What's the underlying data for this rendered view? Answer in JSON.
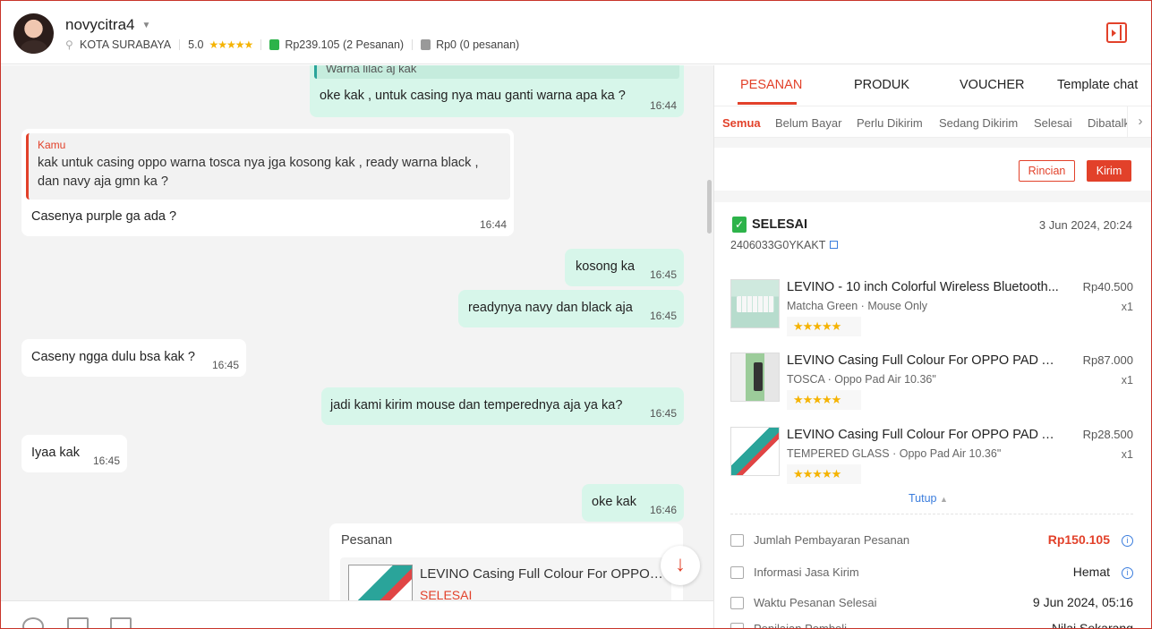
{
  "header": {
    "username": "novycitra4",
    "location": "KOTA SURABAYA",
    "rating": "5.0",
    "stars": "★★★★★",
    "completed_amount": "Rp239.105",
    "completed_count": "(2 Pesanan)",
    "cancelled_amount": "Rp0",
    "cancelled_count": "(0 pesanan)"
  },
  "chat": {
    "messages": [
      {
        "dir": "out",
        "text": "Warna lilac aj kak",
        "time": ""
      },
      {
        "dir": "out",
        "text": "oke kak , untuk casing nya mau ganti warna apa ka ?",
        "time": "16:44"
      },
      {
        "dir": "in",
        "quote_author": "Kamu",
        "quote_text": "kak untuk casing oppo warna tosca nya jga kosong kak , ready warna black , dan navy aja gmn ka ?",
        "text": "Casenya purple ga ada ?",
        "time": "16:44"
      },
      {
        "dir": "out",
        "text": "kosong ka",
        "time": "16:45"
      },
      {
        "dir": "out",
        "text": "readynya navy dan black aja",
        "time": "16:45"
      },
      {
        "dir": "in",
        "text": "Caseny ngga dulu bsa kak ?",
        "time": "16:45"
      },
      {
        "dir": "out",
        "text": "jadi kami kirim mouse dan temperednya aja ya ka?",
        "time": "16:45"
      },
      {
        "dir": "in",
        "text": "Iyaa kak",
        "time": "16:45"
      },
      {
        "dir": "out",
        "text": "oke kak",
        "time": "16:46"
      }
    ],
    "order_card": {
      "label": "Pesanan",
      "title": "LEVINO Casing Full Colour For OPPO PAD AIR...",
      "status": "SELESAI"
    },
    "scroll_down_icon": "↓"
  },
  "right_panel": {
    "tabs": [
      "PESANAN",
      "PRODUK",
      "VOUCHER",
      "Template chat"
    ],
    "subtabs": [
      "Semua",
      "Belum Bayar",
      "Perlu Dikirim",
      "Sedang Dikirim",
      "Selesai",
      "Dibatalkan"
    ],
    "buttons": {
      "rincian": "Rincian",
      "kirim": "Kirim"
    },
    "order": {
      "status": "SELESAI",
      "date": "3 Jun 2024, 20:24",
      "id": "2406033G0YKAKT",
      "items": [
        {
          "name": "LEVINO - 10 inch Colorful Wireless Bluetooth...",
          "variant": "Matcha Green · Mouse Only",
          "price": "Rp40.500",
          "qty": "x1",
          "stars": "★★★★★"
        },
        {
          "name": "LEVINO Casing Full Colour For OPPO PAD AIR...",
          "variant": "TOSCA · Oppo Pad Air 10.36\"",
          "price": "Rp87.000",
          "qty": "x1",
          "stars": "★★★★★"
        },
        {
          "name": "LEVINO Casing Full Colour For OPPO PAD AIR...",
          "variant": "TEMPERED GLASS · Oppo Pad Air 10.36\"",
          "price": "Rp28.500",
          "qty": "x1",
          "stars": "★★★★★"
        }
      ],
      "collapse": "Tutup",
      "info": [
        {
          "label": "Jumlah Pembayaran Pesanan",
          "value": "Rp150.105"
        },
        {
          "label": "Informasi Jasa Kirim",
          "value": "Hemat"
        },
        {
          "label": "Waktu Pesanan Selesai",
          "value": "9 Jun 2024, 05:16"
        },
        {
          "label": "Penilaian Pembeli",
          "value": "Nilai Sekarang"
        }
      ]
    }
  },
  "colors": {
    "accent": "#e2412a",
    "outgoing_bubble": "#d7f6ea",
    "success": "#2db34a",
    "link": "#3b7ddd"
  }
}
